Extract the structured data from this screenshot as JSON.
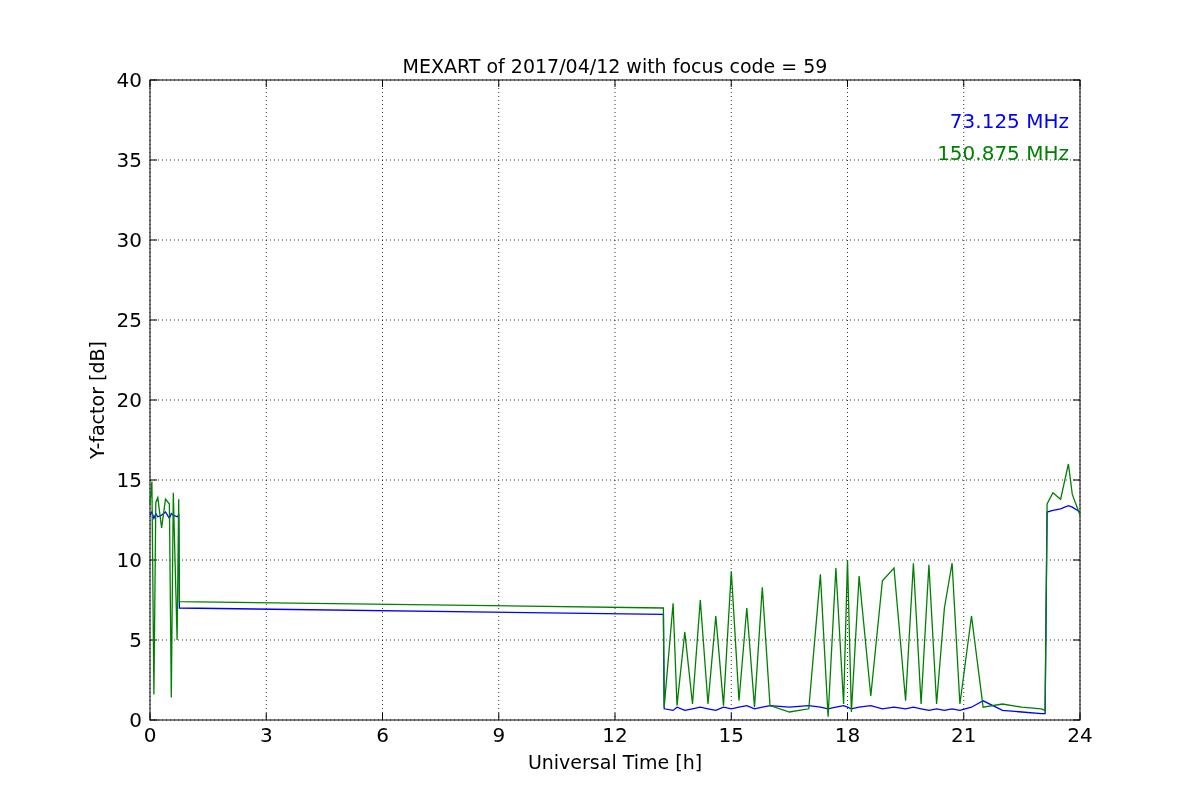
{
  "figure": {
    "chart_data": {
      "type": "line",
      "title": "MEXART of 2017/04/12 with focus code = 59",
      "xlabel": "Universal Time [h]",
      "ylabel": "Y-factor [dB]",
      "x": [
        0,
        0.05,
        0.1,
        0.15,
        0.2,
        0.3,
        0.4,
        0.5,
        0.55,
        0.6,
        0.7,
        0.74,
        0.76,
        13.25,
        13.27,
        13.5,
        13.6,
        13.8,
        14.0,
        14.2,
        14.4,
        14.6,
        14.8,
        15.0,
        15.2,
        15.4,
        15.6,
        15.8,
        16.0,
        16.5,
        17.0,
        17.3,
        17.5,
        17.7,
        17.9,
        18.0,
        18.1,
        18.3,
        18.6,
        18.9,
        19.2,
        19.5,
        19.7,
        19.9,
        20.1,
        20.3,
        20.5,
        20.7,
        20.9,
        21.2,
        21.5,
        22.0,
        22.5,
        23.0,
        23.1,
        23.15,
        23.3,
        23.5,
        23.7,
        23.8,
        24
      ],
      "series": [
        {
          "name": "73.125 MHz",
          "color": "#0000ff",
          "values": [
            12.8,
            13.0,
            12.6,
            12.9,
            12.7,
            12.8,
            13.0,
            12.6,
            12.9,
            12.8,
            12.7,
            12.8,
            7.0,
            6.6,
            0.7,
            0.6,
            0.8,
            0.6,
            0.7,
            0.8,
            0.7,
            0.6,
            0.8,
            0.7,
            0.8,
            0.9,
            0.7,
            0.8,
            0.9,
            0.8,
            0.9,
            0.8,
            0.7,
            0.8,
            0.9,
            0.8,
            0.7,
            0.8,
            0.9,
            0.7,
            0.8,
            0.7,
            0.8,
            0.7,
            0.6,
            0.7,
            0.6,
            0.7,
            0.6,
            0.8,
            1.2,
            0.6,
            0.5,
            0.4,
            0.4,
            13.0,
            13.1,
            13.2,
            13.4,
            13.3,
            13.0
          ]
        },
        {
          "name": "150.875 MHz",
          "color": "#008000",
          "values": [
            13.5,
            14.9,
            1.6,
            13.6,
            13.9,
            12.0,
            13.8,
            13.5,
            1.4,
            14.2,
            5.0,
            13.8,
            7.4,
            7.0,
            0.8,
            7.3,
            0.9,
            5.5,
            1.0,
            7.5,
            1.0,
            6.5,
            0.9,
            9.3,
            1.2,
            7.0,
            0.8,
            8.3,
            0.9,
            0.5,
            0.7,
            9.1,
            0.2,
            9.5,
            1.0,
            10.0,
            0.5,
            9.0,
            1.5,
            8.7,
            9.5,
            1.2,
            9.8,
            1.0,
            9.7,
            1.0,
            7.0,
            9.8,
            1.0,
            6.5,
            0.8,
            1.0,
            0.8,
            0.7,
            0.6,
            13.5,
            14.2,
            13.8,
            16.0,
            14.1,
            12.8
          ]
        }
      ],
      "grid": true,
      "xlim": [
        0,
        24
      ],
      "ylim": [
        0,
        40
      ],
      "xticks": [
        0,
        3,
        6,
        9,
        12,
        15,
        18,
        21,
        24
      ],
      "yticks": [
        0,
        5,
        10,
        15,
        20,
        25,
        30,
        35,
        40
      ]
    }
  }
}
